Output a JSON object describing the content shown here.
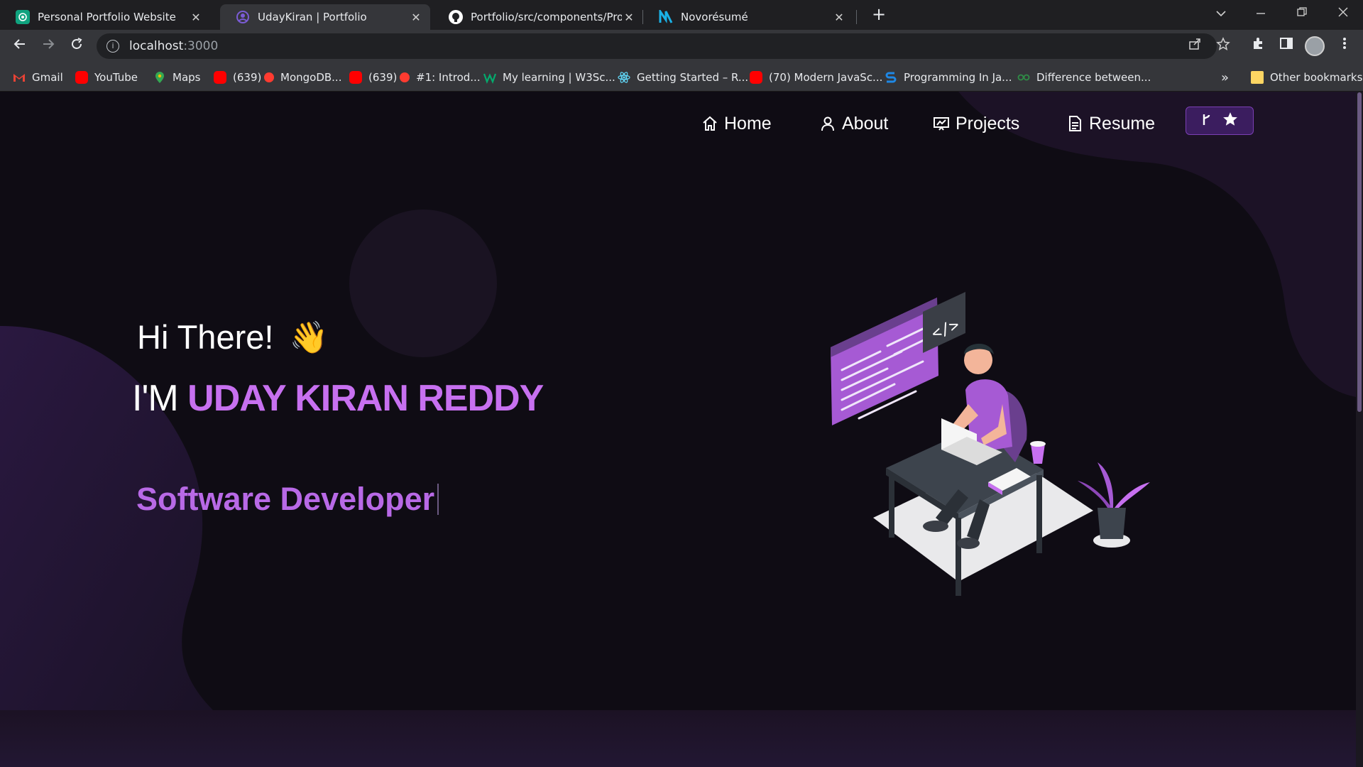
{
  "browser": {
    "tabs": [
      {
        "title": "Personal Portfolio Website",
        "favicon": "chatgpt-icon",
        "active": false
      },
      {
        "title": "UdayKiran | Portfolio",
        "favicon": "portfolio-icon",
        "active": true
      },
      {
        "title": "Portfolio/src/components/Projec",
        "favicon": "github-icon",
        "active": false
      },
      {
        "title": "Novorésumé",
        "favicon": "novoresume-icon",
        "active": false
      }
    ],
    "tab_close": "✕",
    "new_tab": "+",
    "address": {
      "host": "localhost",
      "port": ":3000"
    },
    "bookmarks": [
      {
        "label": "Gmail",
        "icon": "gmail-icon",
        "color": "#ea4335"
      },
      {
        "label": "YouTube",
        "icon": "youtube-icon",
        "color": "#ff0000"
      },
      {
        "label": "Maps",
        "icon": "maps-icon",
        "color": "#34a853"
      },
      {
        "label": "(639)",
        "icon": "youtube-icon",
        "color": "#ff0000"
      },
      {
        "label": "MongoDB...",
        "icon": "record-icon",
        "color": "#ff3b30"
      },
      {
        "label": "(639)",
        "icon": "youtube-icon",
        "color": "#ff0000"
      },
      {
        "label": "#1: Introd...",
        "icon": "record-icon",
        "color": "#ff3b30"
      },
      {
        "label": "My learning | W3Sc...",
        "icon": "w3schools-icon",
        "color": "#04aa6d"
      },
      {
        "label": "Getting Started – R...",
        "icon": "react-icon",
        "color": "#61dafb"
      },
      {
        "label": "(70) Modern JavaSc...",
        "icon": "youtube-icon",
        "color": "#ff0000"
      },
      {
        "label": "Programming In Ja...",
        "icon": "s-icon",
        "color": "#1e88e5"
      },
      {
        "label": "Difference between...",
        "icon": "gfg-icon",
        "color": "#2f8d46"
      }
    ],
    "more_bookmarks": "»",
    "other_bookmarks": "Other bookmarks"
  },
  "site": {
    "nav": [
      {
        "label": "Home",
        "icon": "home-icon"
      },
      {
        "label": "About",
        "icon": "user-icon"
      },
      {
        "label": "Projects",
        "icon": "projects-icon"
      },
      {
        "label": "Resume",
        "icon": "document-icon"
      }
    ],
    "github_button": {
      "icons": [
        "git-fork-icon",
        "star-icon"
      ]
    },
    "hero": {
      "greeting": "Hi There!",
      "wave": "👋",
      "intro_prefix": "I'M ",
      "name": "UDAY KIRAN REDDY",
      "role": "Software Developer"
    }
  },
  "colors": {
    "accent": "#c770f0",
    "background": "#0f0c14",
    "button_bg": "#3b1d5f"
  }
}
